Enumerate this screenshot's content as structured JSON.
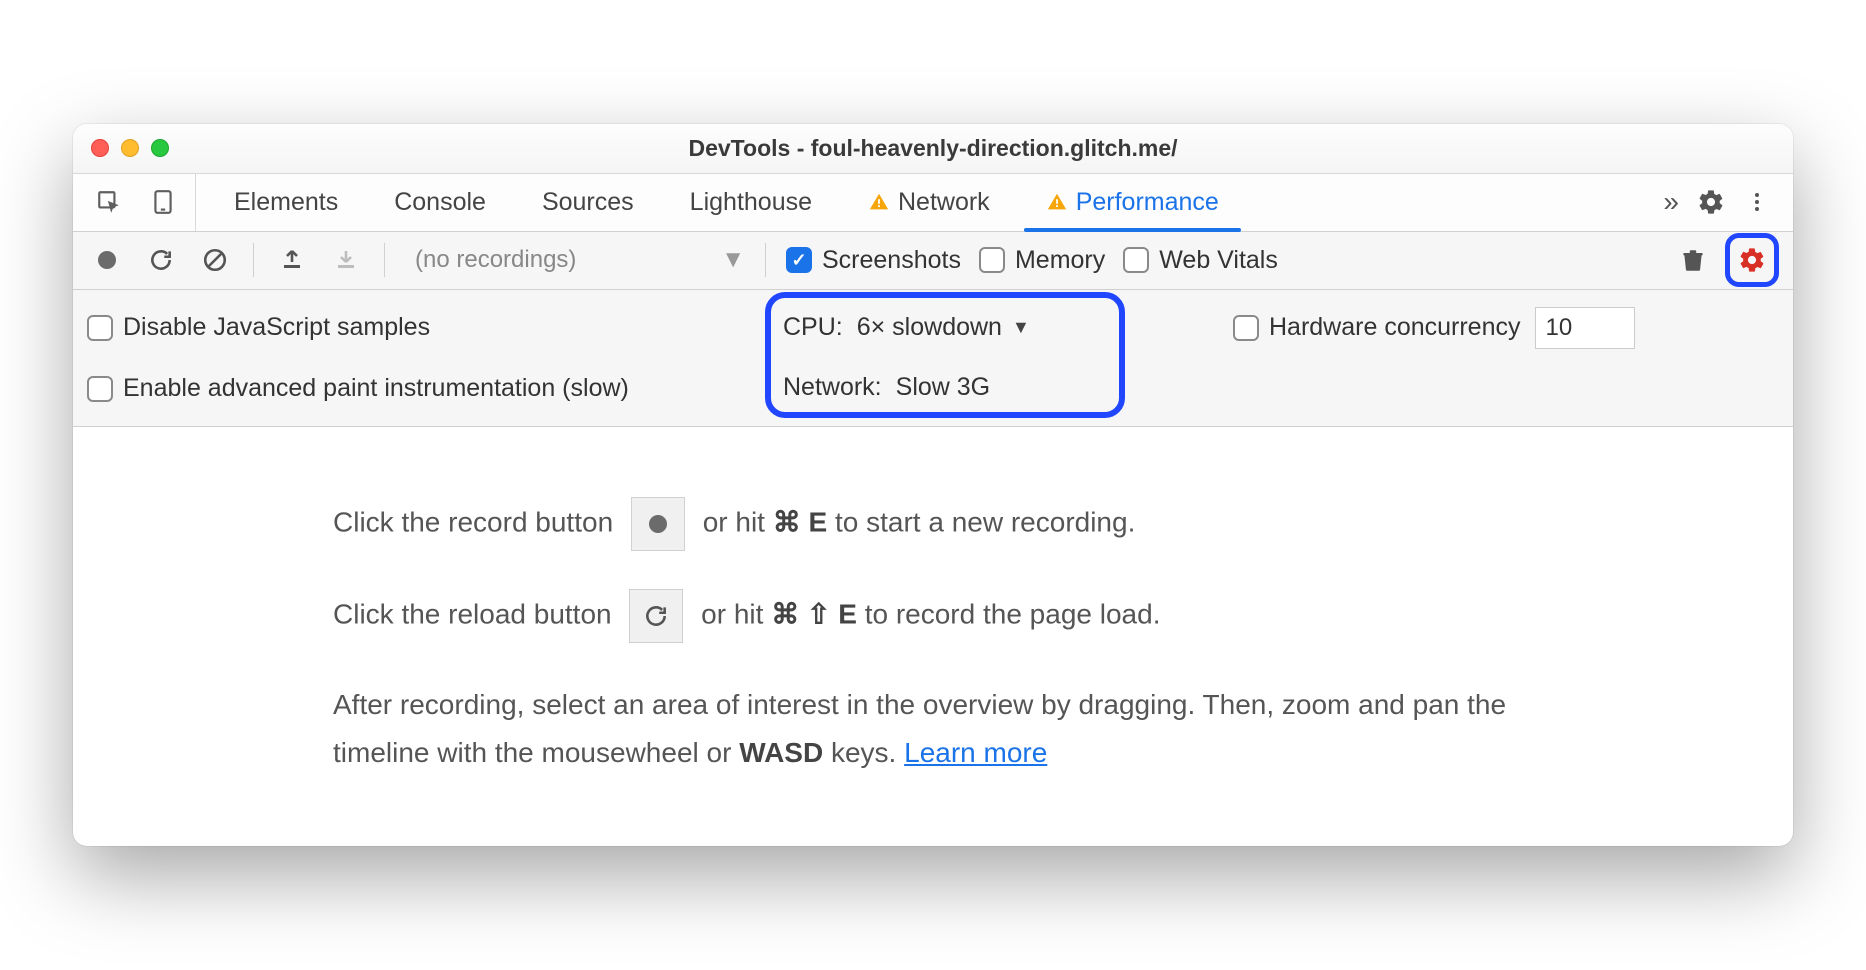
{
  "window": {
    "title": "DevTools - foul-heavenly-direction.glitch.me/"
  },
  "tabs": {
    "items": [
      {
        "label": "Elements"
      },
      {
        "label": "Console"
      },
      {
        "label": "Sources"
      },
      {
        "label": "Lighthouse"
      },
      {
        "label": "Network",
        "warn": true
      },
      {
        "label": "Performance",
        "warn": true,
        "active": true
      }
    ],
    "more": "»"
  },
  "toolbar": {
    "no_recordings": "(no recordings)",
    "screenshots": "Screenshots",
    "memory": "Memory",
    "webvitals": "Web Vitals"
  },
  "settings": {
    "disable_js": "Disable JavaScript samples",
    "enable_paint": "Enable advanced paint instrumentation (slow)",
    "cpu_label": "CPU:",
    "cpu_value": "6× slowdown",
    "net_label": "Network:",
    "net_value": "Slow 3G",
    "hw_label": "Hardware concurrency",
    "hw_value": "10"
  },
  "main": {
    "line1a": "Click the record button ",
    "line1b": " or hit ",
    "line1_key1": "⌘",
    "line1_key2": "E",
    "line1c": " to start a new recording.",
    "line2a": "Click the reload button ",
    "line2b": " or hit ",
    "line2_key1": "⌘",
    "line2_key2": "⇧",
    "line2_key3": "E",
    "line2c": " to record the page load.",
    "line3a": "After recording, select an area of interest in the overview by dragging. Then, zoom and pan the timeline with the mousewheel or ",
    "line3_wasd": "WASD",
    "line3b": " keys. ",
    "learn": "Learn more"
  }
}
